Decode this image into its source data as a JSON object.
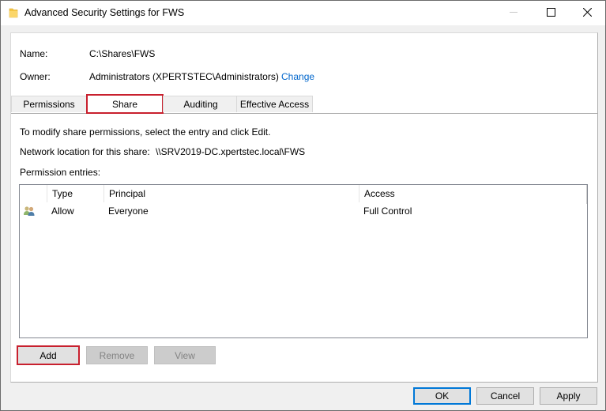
{
  "window": {
    "title": "Advanced Security Settings for FWS",
    "icon": "folder-icon",
    "controls": {
      "minimize": "minimize-icon",
      "maximize": "maximize-icon",
      "close": "close-icon"
    }
  },
  "object": {
    "name_label": "Name:",
    "name_value": "C:\\Shares\\FWS",
    "owner_label": "Owner:",
    "owner_value": "Administrators (XPERTSTEC\\Administrators)",
    "change_link": "Change"
  },
  "tabs": [
    {
      "label": "Permissions",
      "active": false
    },
    {
      "label": "Share",
      "active": true,
      "highlighted": true
    },
    {
      "label": "Auditing",
      "active": false
    },
    {
      "label": "Effective Access",
      "active": false
    }
  ],
  "share": {
    "instructions": "To modify share permissions, select the entry and click Edit.",
    "network_location_label": "Network location for this share:",
    "network_location_value": "\\\\SRV2019-DC.xpertstec.local\\FWS",
    "entries_label": "Permission entries:",
    "columns": [
      "Type",
      "Principal",
      "Access"
    ],
    "entries": [
      {
        "icon": "users-group-icon",
        "type": "Allow",
        "principal": "Everyone",
        "access": "Full Control"
      }
    ]
  },
  "entry_buttons": {
    "add": {
      "label": "Add",
      "enabled": true,
      "highlighted": true
    },
    "remove": {
      "label": "Remove",
      "enabled": false
    },
    "view": {
      "label": "View",
      "enabled": false
    }
  },
  "dialog_buttons": {
    "ok": "OK",
    "cancel": "Cancel",
    "apply": "Apply"
  },
  "colors": {
    "highlight_box": "#c8202e",
    "link": "#0066cc",
    "default_button_border": "#0078d7"
  }
}
